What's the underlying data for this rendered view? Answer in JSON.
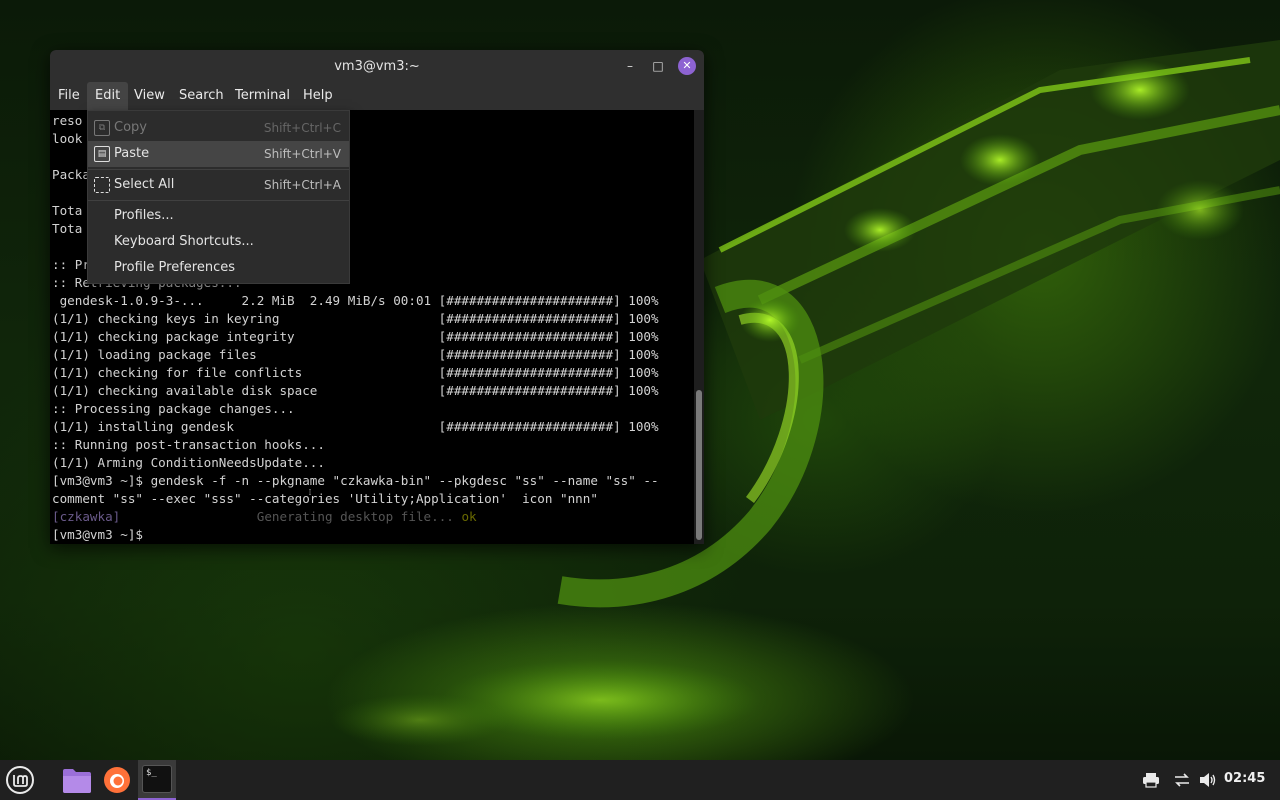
{
  "window": {
    "title": "vm3@vm3:~",
    "controls": {
      "minimize": "–",
      "maximize": "□",
      "close": "✕"
    }
  },
  "menubar": [
    "File",
    "Edit",
    "View",
    "Search",
    "Terminal",
    "Help"
  ],
  "edit_menu": {
    "items": [
      {
        "label": "Copy",
        "shortcut": "Shift+Ctrl+C",
        "icon": "copy-icon",
        "enabled": false
      },
      {
        "label": "Paste",
        "shortcut": "Shift+Ctrl+V",
        "icon": "paste-icon",
        "enabled": true,
        "highlighted": true
      },
      {
        "label": "Select All",
        "shortcut": "Shift+Ctrl+A",
        "icon": "select-all-icon",
        "enabled": true
      },
      {
        "label": "Profiles...",
        "shortcut": "",
        "enabled": true
      },
      {
        "label": "Keyboard Shortcuts...",
        "shortcut": "",
        "enabled": true
      },
      {
        "label": "Profile Preferences",
        "shortcut": "",
        "enabled": true
      }
    ]
  },
  "terminal": {
    "lines": [
      "reso",
      "look",
      "",
      "Packa",
      "",
      "Tota",
      "Tota",
      "",
      ":: Pr",
      ":: Retrieving packages...",
      " gendesk-1.0.9-3-...     2.2 MiB  2.49 MiB/s 00:01 [######################] 100%",
      "(1/1) checking keys in keyring                     [######################] 100%",
      "(1/1) checking package integrity                   [######################] 100%",
      "(1/1) loading package files                        [######################] 100%",
      "(1/1) checking for file conflicts                  [######################] 100%",
      "(1/1) checking available disk space                [######################] 100%",
      ":: Processing package changes...",
      "(1/1) installing gendesk                           [######################] 100%",
      ":: Running post-transaction hooks...",
      "(1/1) Arming ConditionNeedsUpdate...",
      "[vm3@vm3 ~]$ gendesk -f -n --pkgname \"czkawka-bin\" --pkgdesc \"ss\" --name \"ss\" --",
      "comment \"ss\" --exec \"sss\" --categories 'Utility;Application'  icon \"nnn\""
    ],
    "gen_tag": "[czkawka]",
    "gen_text": "Generating desktop file...",
    "gen_ok": "ok",
    "prompt": "[vm3@vm3 ~]$ "
  },
  "taskbar": {
    "apps": [
      "menu-launcher",
      "files",
      "firefox",
      "terminal"
    ],
    "terminal_icon_text": "$_",
    "clock": "02:45"
  },
  "colors": {
    "accent": "#8d63d2",
    "panel": "#202020",
    "titlebar": "#2f2f2f"
  }
}
